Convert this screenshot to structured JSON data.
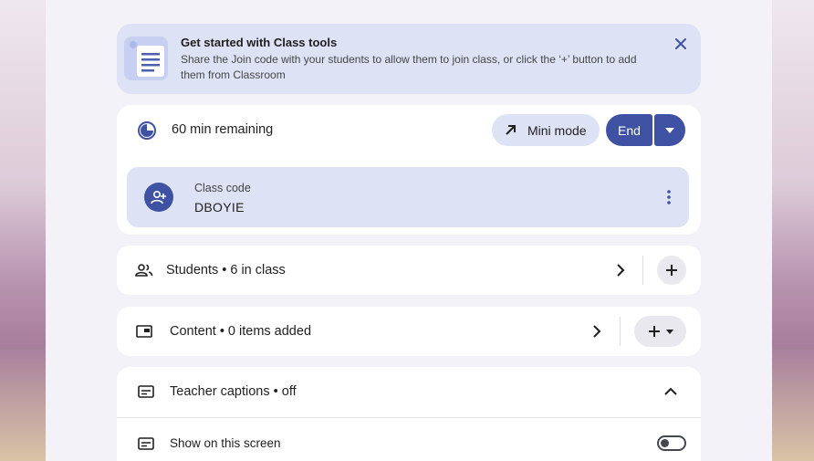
{
  "banner": {
    "title": "Get started with Class tools",
    "body": "Share the Join code with your students to allow them to join class, or click the ‘+’ button to add them from Classroom"
  },
  "session": {
    "time_remaining": "60 min remaining",
    "mini_mode_label": "Mini mode",
    "end_label": "End"
  },
  "class_code": {
    "label": "Class code",
    "value": "DBOYIE"
  },
  "students": {
    "label": "Students • 6 in class"
  },
  "content": {
    "label": "Content • 0 items added"
  },
  "captions": {
    "label": "Teacher captions • off",
    "show_label": "Show on this screen",
    "show_enabled": false
  },
  "colors": {
    "accent": "#3f51a3",
    "tint": "#dde2f5"
  }
}
